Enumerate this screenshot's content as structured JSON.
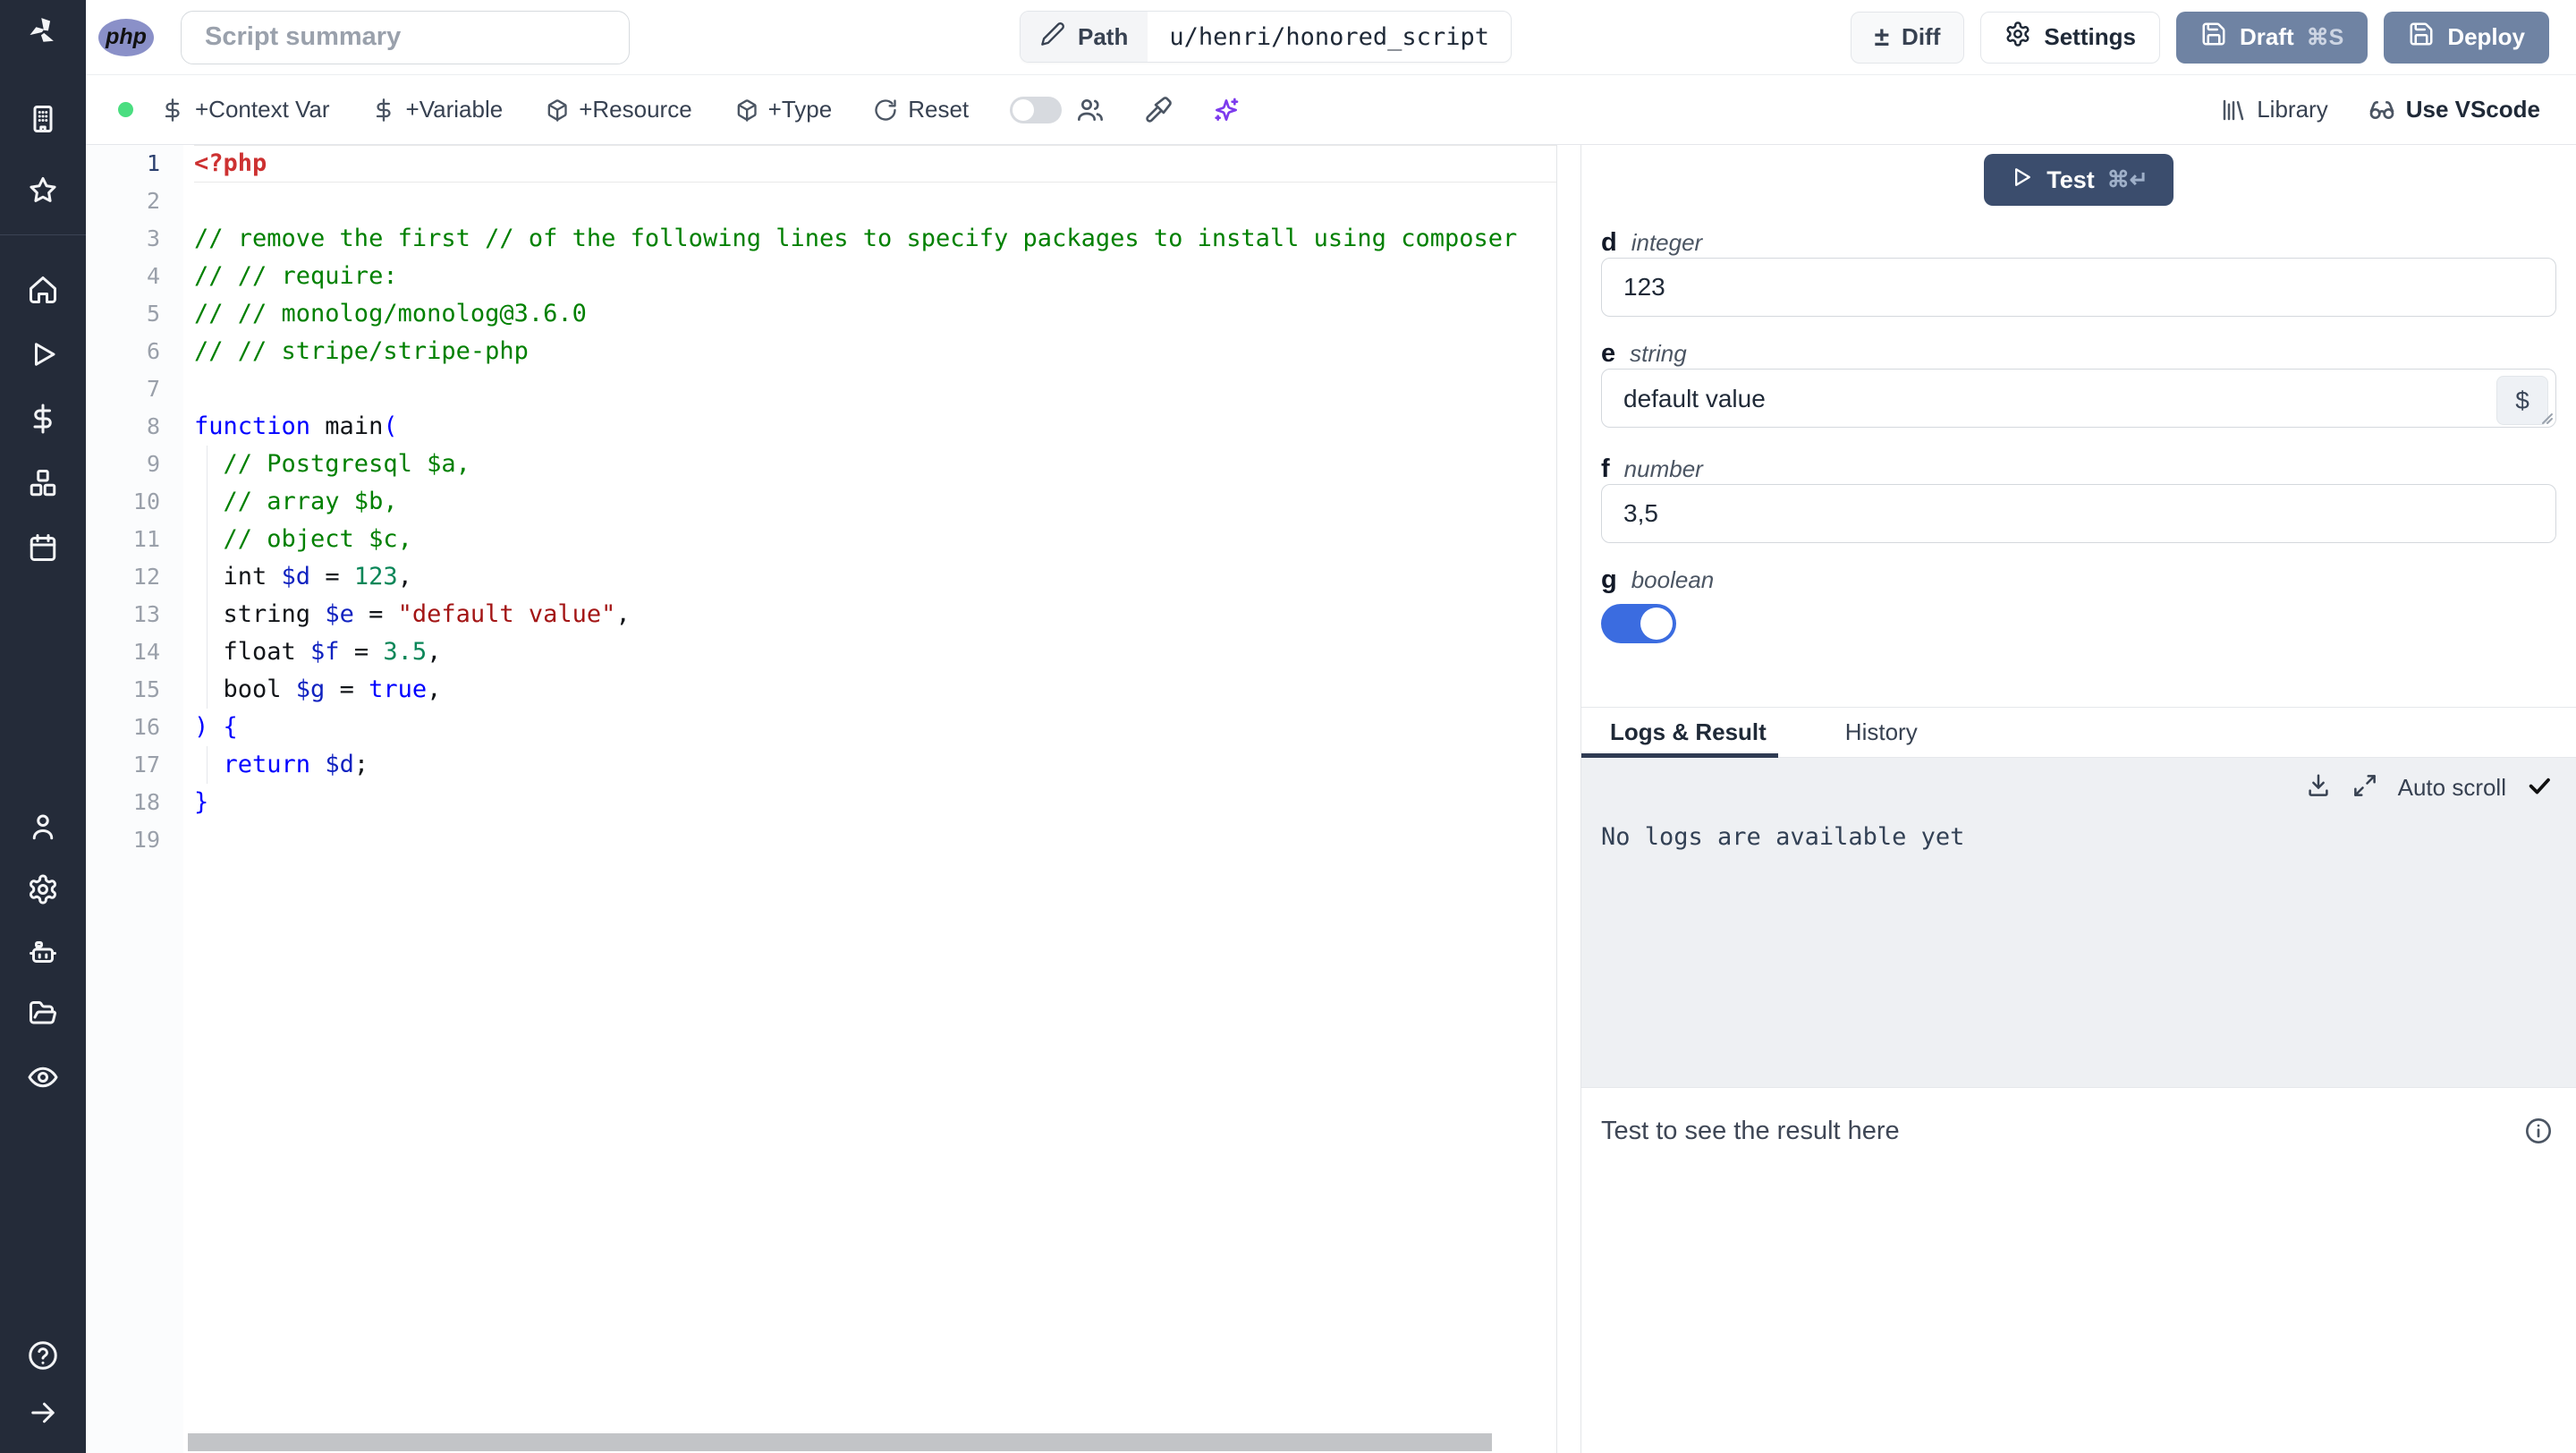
{
  "topbar": {
    "language_badge": "php",
    "summary_placeholder": "Script summary",
    "path_label": "Path",
    "path_value": "u/henri/honored_script",
    "diff_label": "Diff",
    "settings_label": "Settings",
    "draft_label": "Draft",
    "draft_shortcut": "⌘S",
    "deploy_label": "Deploy",
    "diff_symbol": "±"
  },
  "toolbar": {
    "items": [
      "+Context Var",
      "+Variable",
      "+Resource",
      "+Type",
      "Reset"
    ],
    "library_label": "Library",
    "vscode_label": "Use VScode",
    "status_color": "#4ade80",
    "icons": [
      "dollar-icon",
      "dollar-icon",
      "package-icon",
      "package-icon",
      "rotate-icon",
      "users-icon",
      "paintbrush-icon",
      "sparkles-icon",
      "library-icon",
      "glasses-icon"
    ]
  },
  "sidebar": {
    "icons_top": [
      "workspace-building",
      "favorites-star"
    ],
    "icons_nav": [
      "home",
      "runs-play",
      "variables-dollar",
      "resources-cubes",
      "schedules-calendar"
    ],
    "icons_lower": [
      "user",
      "settings-gear",
      "workers-robot",
      "folders-folder",
      "audit-eye"
    ],
    "icons_bottom": [
      "help-question",
      "expand-arrow"
    ]
  },
  "editor": {
    "active_line": 1,
    "lines": [
      {
        "n": 1,
        "tokens": [
          [
            "<?php",
            "m"
          ]
        ]
      },
      {
        "n": 2,
        "tokens": []
      },
      {
        "n": 3,
        "tokens": [
          [
            "// remove the first // of the following lines to specify packages to install using composer",
            "c"
          ]
        ]
      },
      {
        "n": 4,
        "tokens": [
          [
            "// // require:",
            "c"
          ]
        ]
      },
      {
        "n": 5,
        "tokens": [
          [
            "// // monolog/monolog@3.6.0",
            "c"
          ]
        ]
      },
      {
        "n": 6,
        "tokens": [
          [
            "// // stripe/stripe-php",
            "c"
          ]
        ]
      },
      {
        "n": 7,
        "tokens": []
      },
      {
        "n": 8,
        "tokens": [
          [
            "function",
            "k"
          ],
          [
            " main",
            "p"
          ],
          [
            "(",
            "k"
          ]
        ]
      },
      {
        "n": 9,
        "g": 1,
        "tokens": [
          [
            "  // Postgresql $a,",
            "c"
          ]
        ]
      },
      {
        "n": 10,
        "g": 1,
        "tokens": [
          [
            "  // array $b,",
            "c"
          ]
        ]
      },
      {
        "n": 11,
        "g": 1,
        "tokens": [
          [
            "  // object $c,",
            "c"
          ]
        ]
      },
      {
        "n": 12,
        "g": 1,
        "tokens": [
          [
            "  int ",
            "p"
          ],
          [
            "$d",
            "v"
          ],
          [
            " = ",
            "p"
          ],
          [
            "123",
            "n"
          ],
          [
            ",",
            "p"
          ]
        ]
      },
      {
        "n": 13,
        "g": 1,
        "tokens": [
          [
            "  string ",
            "p"
          ],
          [
            "$e",
            "v"
          ],
          [
            " = ",
            "p"
          ],
          [
            "\"default value\"",
            "s"
          ],
          [
            ",",
            "p"
          ]
        ]
      },
      {
        "n": 14,
        "g": 1,
        "tokens": [
          [
            "  float ",
            "p"
          ],
          [
            "$f",
            "v"
          ],
          [
            " = ",
            "p"
          ],
          [
            "3.5",
            "n"
          ],
          [
            ",",
            "p"
          ]
        ]
      },
      {
        "n": 15,
        "g": 1,
        "tokens": [
          [
            "  bool ",
            "p"
          ],
          [
            "$g",
            "v"
          ],
          [
            " = ",
            "p"
          ],
          [
            "true",
            "k"
          ],
          [
            ",",
            "p"
          ]
        ]
      },
      {
        "n": 16,
        "tokens": [
          [
            ") {",
            "k"
          ]
        ]
      },
      {
        "n": 17,
        "g": 1,
        "tokens": [
          [
            "  return",
            "k"
          ],
          [
            " ",
            "p"
          ],
          [
            "$d",
            "v"
          ],
          [
            ";",
            "p"
          ]
        ]
      },
      {
        "n": 18,
        "tokens": [
          [
            "}",
            "k"
          ]
        ]
      },
      {
        "n": 19,
        "tokens": []
      }
    ]
  },
  "run_panel": {
    "test_label": "Test",
    "test_shortcut": "⌘↵",
    "args": [
      {
        "name": "d",
        "type": "integer",
        "value": "123"
      },
      {
        "name": "e",
        "type": "string",
        "value": "default value"
      },
      {
        "name": "f",
        "type": "number",
        "value": "3,5"
      },
      {
        "name": "g",
        "type": "boolean",
        "value": "on"
      }
    ],
    "var_picker": "$",
    "tabs": {
      "logs": "Logs & Result",
      "history": "History"
    },
    "auto_scroll_label": "Auto scroll",
    "logs_empty": "No logs are available yet",
    "result_placeholder": "Test to see the result here"
  },
  "colors": {
    "accent_dark_button": "#3b4d6d",
    "slate_button": "#6f83a3",
    "toggle_on": "#3b6ce0",
    "status_green": "#4ade80",
    "php_badge": "#8a90c8",
    "sidebar_bg": "#242b39",
    "ai_sparkle": "#7c3aed"
  }
}
